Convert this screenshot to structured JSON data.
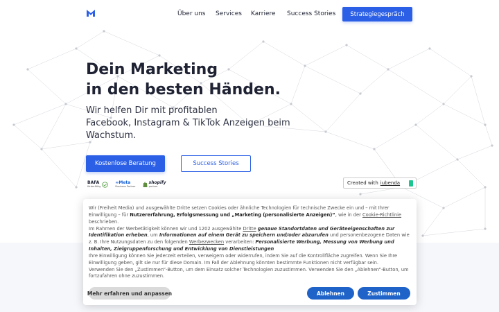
{
  "brand": {
    "logo_icon": "m-logo-icon",
    "accent_color": "#2b5fe6"
  },
  "nav": {
    "items": [
      {
        "label": "Über uns"
      },
      {
        "label": "Services"
      },
      {
        "label": "Karriere"
      },
      {
        "label": "Success Stories"
      }
    ],
    "cta_label": "Strategiegespräch"
  },
  "hero": {
    "title_line1": "Dein Marketing",
    "title_line2": "in den besten Händen.",
    "subtitle_line1": "Wir helfen Dir mit profitablen",
    "subtitle_line2": "Facebook, Instagram & TikTok Anzeigen beim",
    "subtitle_line3": "Wachstum.",
    "primary_button": "Kostenlose Beratung",
    "secondary_button": "Success Stories"
  },
  "badges": [
    {
      "main": "BAFA",
      "sub": "förderfähig",
      "icon": "check-circle-icon"
    },
    {
      "main": "∞Meta",
      "sub": "Business Partner",
      "icon": "meta-icon"
    },
    {
      "main": "shopify",
      "sub": "partner",
      "icon": "shopify-bag-icon"
    }
  ],
  "iubenda": {
    "prefix": "Created with",
    "link": "iubenda",
    "icon": "iubenda-icon"
  },
  "cookie": {
    "p1_a": "Wir (Freiheit Media) und ausgewählte Dritte setzen Cookies oder ähnliche Technologien für technische Zwecke ein und – mit Ihrer Einwilligung – für ",
    "p1_b": "Nutzererfahrung, Erfolgsmessung und „Marketing (personalisierte Anzeigen)“",
    "p1_c": ", wie in der ",
    "p1_link": "Cookie-Richtlinie",
    "p1_d": " beschrieben.",
    "p2_a": "Im Rahmen der Werbetätigkeit können wir und 1202 ausgewählte ",
    "p2_link1": "Dritte",
    "p2_b": " ",
    "p2_i1": "genaue Standortdaten und Geräteeigenschaften zur Identifikation erheben",
    "p2_c": ", um ",
    "p2_i2": "Informationen auf einem Gerät zu speichern und/oder abzurufen",
    "p2_d": " und personenbezogene Daten wie z. B. Ihre Nutzungsdaten zu den folgenden ",
    "p2_link2": "Werbezwecken",
    "p2_e": " verarbeiten: ",
    "p2_i3": "Personalisierte Werbung, Messung von Werbung und Inhalten, Zielgruppenforschung und Entwicklung von Dienstleistungen",
    "p3": "Ihre Einwilligung können Sie jederzeit erteilen, verweigern oder widerrufen, indem Sie auf die Kontrollfläche zugreifen. Wenn Sie Ihre Einwilligung geben, gilt sie nur für diese Domain. Im Fall der Ablehnung könnten bestimmte Funktionen nicht verfügbar sein.",
    "p4": "Verwenden Sie den „Zustimmen“-Button, um dem Einsatz solcher Technologien zuzustimmen. Verwenden Sie den „Ablehnen“-Button, um fortzufahren ohne zuzustimmen.",
    "btn_more": "Mehr erfahren und anpassen",
    "btn_reject": "Ablehnen",
    "btn_accept": "Zustimmen"
  }
}
